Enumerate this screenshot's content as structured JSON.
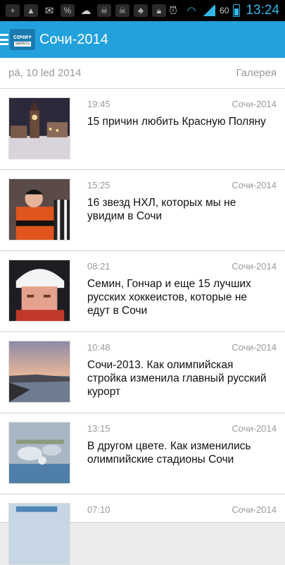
{
  "status_bar": {
    "battery_level": "60",
    "time": "13:24",
    "icons": [
      "plus-icon",
      "image-icon",
      "mail-icon",
      "percent-icon",
      "weather-icon",
      "skull-icon",
      "skull-icon",
      "evernote-icon",
      "lock-icon",
      "alarm-icon",
      "wifi-icon",
      "signal-icon",
      "battery-icon"
    ]
  },
  "app_bar": {
    "logo_text": "сочи+",
    "logo_sub": "sports.ru",
    "title": "Сочи-2014"
  },
  "date_header": {
    "date": "pá, 10 led 2014",
    "gallery": "Галерея"
  },
  "news": [
    {
      "time": "19:45",
      "category": "Сочи-2014",
      "title": "15 причин любить Красную Поляну",
      "image": "clock-tower-night-photo"
    },
    {
      "time": "15:25",
      "category": "Сочи-2014",
      "title": "16 звезд НХЛ, которых мы не увидим в Сочи",
      "image": "hockey-flyers-player-photo"
    },
    {
      "time": "08:21",
      "category": "Сочи-2014",
      "title": "Семин, Гончар и еще 15 лучших русских хоккеистов, которые не едут в Сочи",
      "image": "hockey-player-helmet-photo"
    },
    {
      "time": "10:48",
      "category": "Сочи-2014",
      "title": "Сочи-2013. Как олимпийская стройка изменила главный русский курорт",
      "image": "sochi-coast-sunset-photo"
    },
    {
      "time": "13:15",
      "category": "Сочи-2014",
      "title": "В другом цвете. Как изменились олимпийские стадионы Сочи",
      "image": "olympic-park-aerial-photo"
    },
    {
      "time": "07:10",
      "category": "Сочи-2014",
      "title": "",
      "image": "partial-photo"
    }
  ]
}
